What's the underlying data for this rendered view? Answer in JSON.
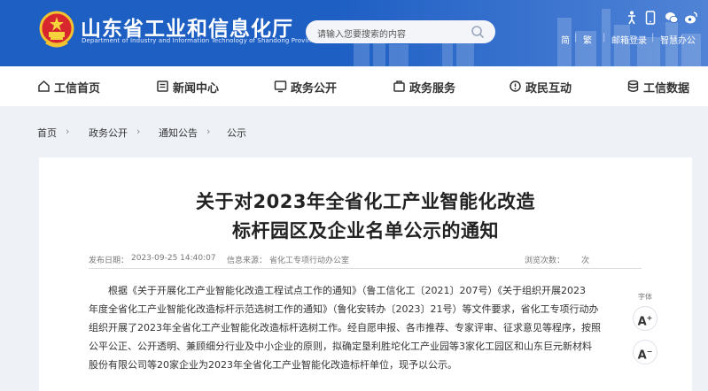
{
  "header": {
    "title": "山东省工业和信息化厅",
    "subtitle": "Department of Industry and Information Technology of Shandong Province",
    "search_placeholder": "请输入您要搜索的内容",
    "links": [
      "简",
      "繁",
      "邮箱登录",
      "智慧办公"
    ],
    "icons": [
      "accessibility-icon",
      "mobile-icon",
      "wechat-icon",
      "weibo-icon"
    ]
  },
  "nav": {
    "items": [
      {
        "label": "工信首页",
        "icon": "home-icon"
      },
      {
        "label": "新闻中心",
        "icon": "news-icon"
      },
      {
        "label": "政务公开",
        "icon": "monitor-icon"
      },
      {
        "label": "政务服务",
        "icon": "service-icon"
      },
      {
        "label": "政民互动",
        "icon": "interaction-icon"
      },
      {
        "label": "工信数据",
        "icon": "database-icon"
      }
    ]
  },
  "breadcrumb": {
    "items": [
      "首页",
      "政务公开",
      "通知公告",
      "公示"
    ],
    "separator": "›"
  },
  "article": {
    "title_line1": "关于对2023年全省化工产业智能化改造",
    "title_line2": "标杆园区及企业名单公示的通知",
    "publish_label": "发布日期：",
    "publish_date": "2023-09-25 14:40:07",
    "source_label": "信息来源：",
    "source": "省化工专项行动办公室",
    "views_label": "浏览次数：",
    "views_unit": "次",
    "body_lines": [
      "根据《关于开展化工产业智能化改造工程试点工作的通知》（鲁工信化工〔2021〕207号）《关于组织开展2023",
      "年度全省化工产业智能化改造标杆示范选树工作的通知》（鲁化安转办〔2023〕21号）等文件要求，省化工专项行动办",
      "组织开展了2023年全省化工产业智能化改造标杆选树工作。经自愿申报、各市推荐、专家评审、征求意见等程序，按照",
      "公平公正、公开透明、兼顾细分行业及中小企业的原则，拟确定垦利胜坨化工产业园等3家化工园区和山东巨元新材料",
      "股份有限公司等20家企业为2023年全省化工产业智能化改造标杆单位，现予以公示。"
    ]
  },
  "font_tools": {
    "label": "字体",
    "increase": "A",
    "increase_sign": "+",
    "decrease": "A",
    "decrease_sign": "−"
  },
  "colors": {
    "brand_blue": "#1e5fc4"
  }
}
